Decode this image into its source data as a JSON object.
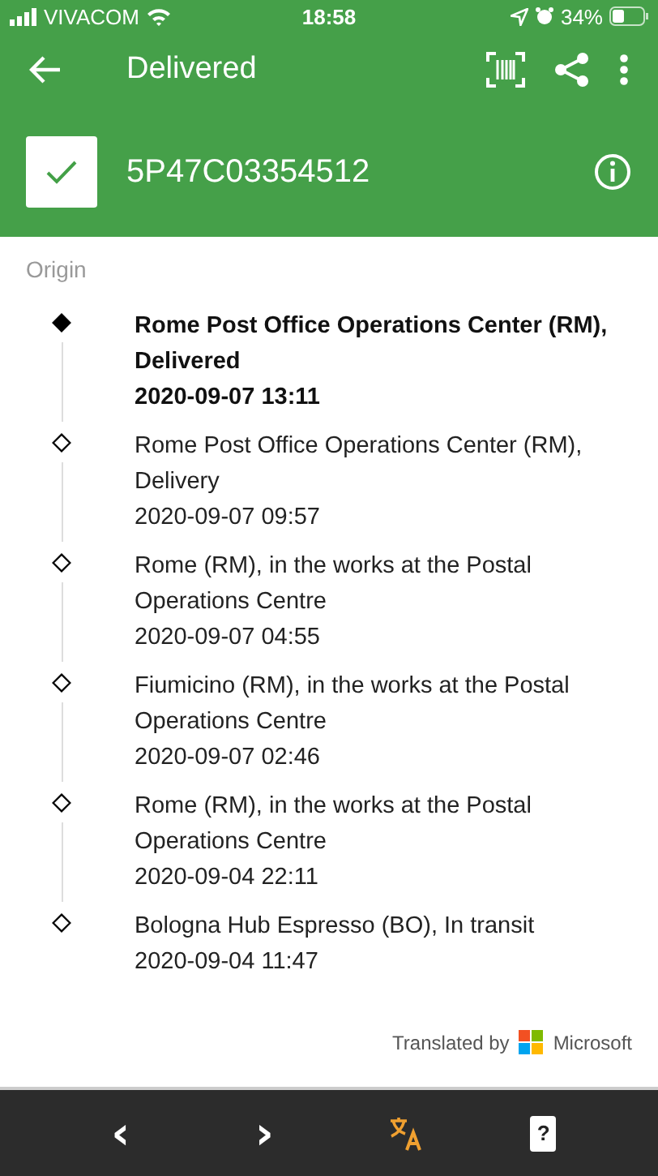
{
  "status_bar": {
    "carrier": "VIVACOM",
    "time": "18:58",
    "battery": "34%"
  },
  "app_bar": {
    "title": "Delivered"
  },
  "shipment": {
    "tracking_number": "5P47C03354512",
    "delivered": true
  },
  "section_label": "Origin",
  "events": [
    {
      "description": "Rome Post Office Operations Center (RM), Delivered",
      "datetime": "2020-09-07 13:11",
      "current": true
    },
    {
      "description": "Rome Post Office Operations Center (RM), Delivery",
      "datetime": "2020-09-07 09:57",
      "current": false
    },
    {
      "description": "Rome (RM), in the works at the Postal Operations Centre",
      "datetime": "2020-09-07 04:55",
      "current": false
    },
    {
      "description": "Fiumicino (RM), in the works at the Postal Operations Centre",
      "datetime": "2020-09-07 02:46",
      "current": false
    },
    {
      "description": "Rome (RM), in the works at the Postal Operations Centre",
      "datetime": "2020-09-04 22:11",
      "current": false
    },
    {
      "description": "Bologna Hub Espresso (BO), In transit",
      "datetime": "2020-09-04 11:47",
      "current": false
    }
  ],
  "attribution": {
    "prefix": "Translated by",
    "brand": "Microsoft"
  },
  "toolbar": {
    "prev": "‹",
    "next": "›",
    "help_key": "?"
  }
}
